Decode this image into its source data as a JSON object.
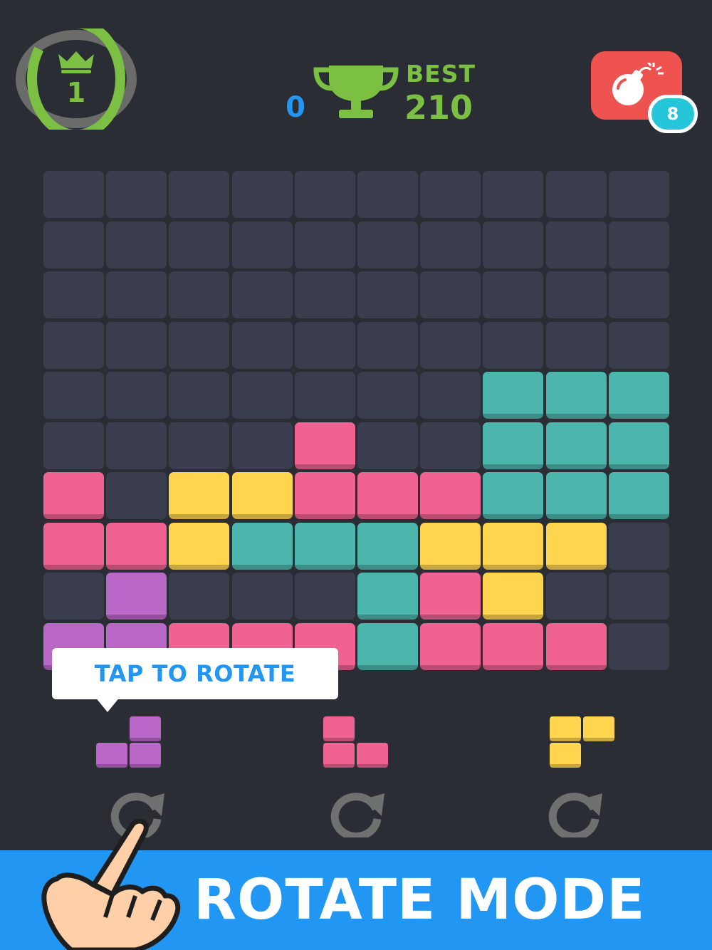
{
  "header": {
    "level": "1",
    "level_progress": 0.85,
    "score": "0",
    "best_label": "BEST",
    "best_value": "210",
    "bomb_count": "8"
  },
  "colors": {
    "background": "#2b2d35",
    "empty_cell": "#3a3d4e",
    "pink": "#f06292",
    "yellow": "#ffd54f",
    "teal": "#4db6ac",
    "purple": "#ba68c8",
    "accent_green": "#7cc043",
    "accent_blue": "#2196f3",
    "bomb_red": "#ef5350",
    "badge_cyan": "#26c6da"
  },
  "board": {
    "rows": [
      [
        "",
        "",
        "",
        "",
        "",
        "",
        "",
        "",
        "",
        ""
      ],
      [
        "",
        "",
        "",
        "",
        "",
        "",
        "",
        "",
        "",
        ""
      ],
      [
        "",
        "",
        "",
        "",
        "",
        "",
        "",
        "",
        "",
        ""
      ],
      [
        "",
        "",
        "",
        "",
        "",
        "",
        "",
        "",
        "",
        ""
      ],
      [
        "",
        "",
        "",
        "",
        "",
        "",
        "",
        "teal",
        "teal",
        "teal"
      ],
      [
        "",
        "",
        "",
        "",
        "pink",
        "",
        "",
        "teal",
        "teal",
        "teal"
      ],
      [
        "pink",
        "",
        "yellow",
        "yellow",
        "pink",
        "pink",
        "pink",
        "teal",
        "teal",
        "teal"
      ],
      [
        "pink",
        "pink",
        "yellow",
        "teal",
        "teal",
        "teal",
        "yellow",
        "yellow",
        "yellow",
        ""
      ],
      [
        "",
        "purple",
        "",
        "",
        "",
        "teal",
        "pink",
        "yellow",
        "",
        ""
      ],
      [
        "purple",
        "purple",
        "pink",
        "pink",
        "pink",
        "teal",
        "pink",
        "pink",
        "pink",
        ""
      ]
    ]
  },
  "tooltip": {
    "text": "TAP TO ROTATE"
  },
  "pieces": [
    {
      "color": "purple",
      "cells": [
        [
          1,
          0
        ],
        [
          0,
          1
        ],
        [
          1,
          1
        ]
      ]
    },
    {
      "color": "pink",
      "cells": [
        [
          0,
          0
        ],
        [
          0,
          1
        ],
        [
          1,
          1
        ]
      ]
    },
    {
      "color": "yellow",
      "cells": [
        [
          0,
          0
        ],
        [
          1,
          0
        ],
        [
          0,
          1
        ]
      ]
    }
  ],
  "icons": {
    "level": "crown-icon",
    "best": "trophy-icon",
    "bomb": "bomb-icon",
    "rotate": "rotate-icon",
    "hand": "pointing-hand-icon"
  },
  "banner": {
    "text": "ROTATE MODE"
  }
}
